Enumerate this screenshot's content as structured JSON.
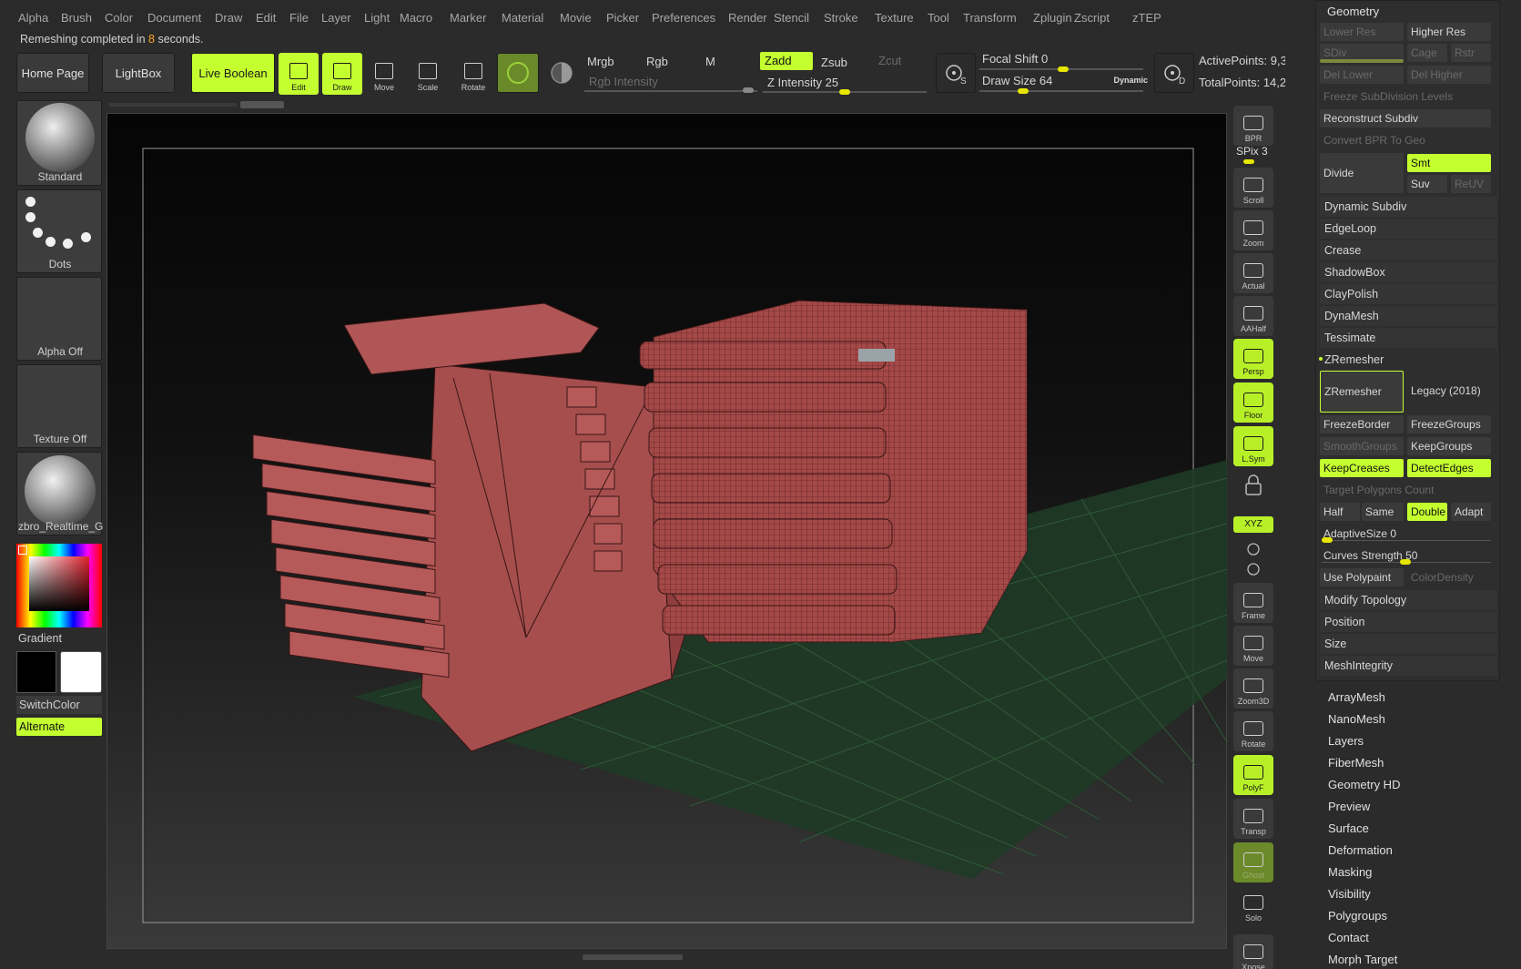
{
  "menu": [
    "Alpha",
    "Brush",
    "Color",
    "Document",
    "Draw",
    "Edit",
    "File",
    "Layer",
    "Light",
    "Macro",
    "Marker",
    "Material",
    "Movie",
    "Picker",
    "Preferences",
    "Render",
    "Stencil",
    "Stroke",
    "Texture",
    "Tool",
    "Transform",
    "Zplugin",
    "Zscript",
    "zTEP"
  ],
  "status": {
    "prefix": "Remeshing completed in ",
    "seconds": "8",
    "suffix": " seconds."
  },
  "toolbar": {
    "home_page": "Home Page",
    "lightbox": "LightBox",
    "live_boolean": "Live Boolean",
    "edit": "Edit",
    "draw": "Draw",
    "move": "Move",
    "scale": "Scale",
    "rotate": "Rotate",
    "mrgb": "Mrgb",
    "rgb": "Rgb",
    "m": "M",
    "zadd": "Zadd",
    "zsub": "Zsub",
    "zcut": "Zcut",
    "rgb_intensity": "Rgb Intensity",
    "z_intensity_label": "Z Intensity",
    "z_intensity": "25",
    "focal_shift_label": "Focal Shift",
    "focal_shift": "0",
    "draw_size_label": "Draw Size",
    "draw_size": "64",
    "dynamic": "Dynamic",
    "active_points": "ActivePoints: 9,3",
    "total_points": "TotalPoints: 14,2"
  },
  "left_panel": {
    "brush": "Standard",
    "stroke": "Dots",
    "alpha": "Alpha Off",
    "texture": "Texture Off",
    "material": "zbro_Realtime_G",
    "gradient": "Gradient",
    "switch_color": "SwitchColor",
    "alternate": "Alternate"
  },
  "right_icons": [
    {
      "label": "BPR",
      "state": "normal"
    },
    {
      "label": "Scroll",
      "state": "normal"
    },
    {
      "label": "Zoom",
      "state": "normal"
    },
    {
      "label": "Actual",
      "state": "normal"
    },
    {
      "label": "AAHalf",
      "state": "normal"
    },
    {
      "label": "Persp",
      "state": "lime"
    },
    {
      "label": "Floor",
      "state": "lime"
    },
    {
      "label": "L.Sym",
      "state": "lime"
    },
    {
      "label": "Frame",
      "state": "normal"
    },
    {
      "label": "Move",
      "state": "normal"
    },
    {
      "label": "Zoom3D",
      "state": "normal"
    },
    {
      "label": "Rotate",
      "state": "normal"
    },
    {
      "label": "PolyF",
      "state": "lime"
    },
    {
      "label": "Transp",
      "state": "normal"
    },
    {
      "label": "Ghost",
      "state": "olive"
    },
    {
      "label": "Solo",
      "state": "normal"
    },
    {
      "label": "Xpose",
      "state": "normal"
    }
  ],
  "spix": {
    "label": "SPix",
    "value": "3"
  },
  "xyz": "XYZ",
  "right_panel": {
    "title": "Geometry",
    "lower_res": "Lower Res",
    "higher_res": "Higher Res",
    "sdiv": "SDiv",
    "cage": "Cage",
    "rstr": "Rstr",
    "del_lower": "Del Lower",
    "del_higher": "Del Higher",
    "freeze_subdiv": "Freeze SubDivision Levels",
    "reconstruct": "Reconstruct Subdiv",
    "convert_bpr": "Convert BPR To Geo",
    "divide": "Divide",
    "smt": "Smt",
    "suv": "Suv",
    "reuv": "ReUV",
    "sections": [
      "Dynamic Subdiv",
      "EdgeLoop",
      "Crease",
      "ShadowBox",
      "ClayPolish",
      "DynaMesh",
      "Tessimate"
    ],
    "zremesher_title": "ZRemesher",
    "zremesher_btn": "ZRemesher",
    "legacy": "Legacy (2018)",
    "freeze_border": "FreezeBorder",
    "freeze_groups": "FreezeGroups",
    "smooth_groups": "SmoothGroups",
    "keep_groups": "KeepGroups",
    "keep_creases": "KeepCreases",
    "detect_edges": "DetectEdges",
    "target_polys": "Target Polygons Count",
    "half": "Half",
    "same": "Same",
    "double": "Double",
    "adapt": "Adapt",
    "adaptive_size_label": "AdaptiveSize",
    "adaptive_size": "0",
    "curves_strength_label": "Curves Strength",
    "curves_strength": "50",
    "use_polypaint": "Use Polypaint",
    "color_density": "ColorDensity",
    "sections2": [
      "Modify Topology",
      "Position",
      "Size",
      "MeshIntegrity"
    ]
  },
  "subpalettes": [
    "ArrayMesh",
    "NanoMesh",
    "Layers",
    "FiberMesh",
    "Geometry HD",
    "Preview",
    "Surface",
    "Deformation",
    "Masking",
    "Visibility",
    "Polygroups",
    "Contact",
    "Morph Target"
  ]
}
